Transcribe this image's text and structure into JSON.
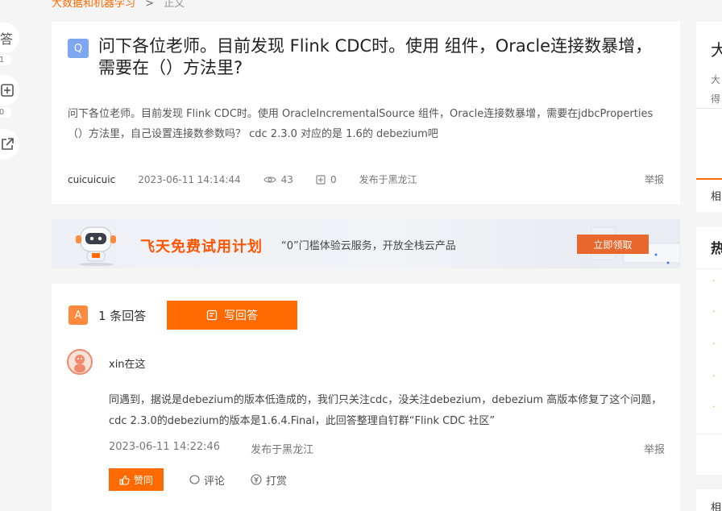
{
  "breadcrumb": {
    "parent": "大数据和机器学习",
    "separator": ">",
    "current": "正文"
  },
  "left_tools": {
    "answer_label": "答",
    "answer_count": "1",
    "follow_count": "0"
  },
  "question": {
    "badge": "Q",
    "title": "问下各位老师。目前发现 Flink CDC时。使用 组件，Oracle连接数暴增，需要在（）方法里?",
    "body": "问下各位老师。目前发现 Flink CDC时。使用 OracleIncrementalSource 组件，Oracle连接数暴增，需要在jdbcProperties（）方法里，自己设置连接数参数吗？ cdc 2.3.0 对应的是 1.6的 debezium吧",
    "author": "cuicuicuic",
    "date": "2023-06-11 14:14:44",
    "views": "43",
    "follows": "0",
    "location": "发布于黑龙江",
    "report": "举报"
  },
  "banner": {
    "title": "飞天免费试用计划",
    "subtitle": "“0”门槛体验云服务，开放全栈云产品",
    "button": "立即领取"
  },
  "answers": {
    "badge": "A",
    "count_label": "1 条回答",
    "write_label": "写回答",
    "items": [
      {
        "user": "xin在这",
        "body": "同遇到，据说是debezium的版本低造成的，我们只关注cdc，没关注debezium，debezium 高版本修复了这个问题，cdc 2.3.0的debezium的版本是1.6.4.Final，此回答整理自钉群“Flink CDC 社区”",
        "date": "2023-06-11 14:22:46",
        "location": "发布于黑龙江",
        "report": "举报",
        "like": "赞同",
        "comment": "评论",
        "reward": "打赏"
      }
    ]
  },
  "sidebar": {
    "card1_title": "大",
    "card1_line1": "大",
    "card1_line2": "得",
    "card2_text": "相",
    "card3_title": "热",
    "card4_text": "相"
  },
  "colors": {
    "accent": "#ff6a00",
    "question_badge": "#7fa6f0",
    "answer_badge": "#ff8a3d"
  }
}
